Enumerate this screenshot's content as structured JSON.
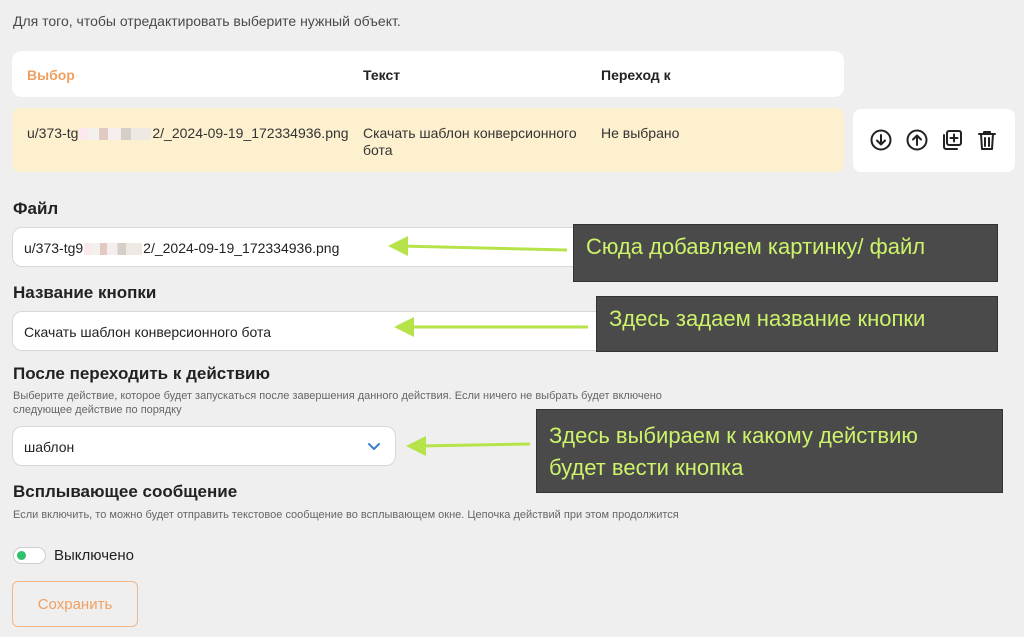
{
  "intro": "Для того, чтобы отредактировать выберите нужный объект.",
  "table": {
    "headers": {
      "choice": "Выбор",
      "text": "Текст",
      "goto": "Переход к"
    },
    "row": {
      "file_start": "u/373-tg",
      "file_end": "2/_2024-09-19_172334936.png",
      "text": "Скачать шаблон конверсионного бота",
      "goto": "Не выбрано"
    }
  },
  "actions": {
    "icons": [
      "arrow-down-circle-icon",
      "arrow-up-circle-icon",
      "copy-plus-icon",
      "trash-icon"
    ]
  },
  "file": {
    "label": "Файл",
    "value_start": "u/373-tg9",
    "value_end": "2/_2024-09-19_172334936.png"
  },
  "button_name": {
    "label": "Название кнопки",
    "value": "Скачать шаблон конверсионного бота"
  },
  "after_action": {
    "label": "После переходить к действию",
    "hint": "Выберите действие, которое будет запускаться после завершения данного действия. Если ничего не выбрать будет включено следующее действие по порядку",
    "selected": "шаблон"
  },
  "popup": {
    "label": "Всплывающее сообщение",
    "hint": "Если включить, то можно будет отправить текстовое сообщение во всплывающем окне. Цепочка действий при этом продолжится",
    "toggle_state": "Выключено"
  },
  "save_label": "Сохранить",
  "annotations": {
    "file": "Сюда добавляем картинку/ файл",
    "name": "Здесь задаем название кнопки",
    "action_line1": "Здесь выбираем к какому действию",
    "action_line2": "будет вести кнопка"
  },
  "colors": {
    "accent": "#f0a060",
    "annotation_text": "#cdf36a",
    "annotation_bg": "#4a4a4a",
    "row_highlight": "#fdf0cf",
    "toggle_knob": "#2fc26b"
  }
}
